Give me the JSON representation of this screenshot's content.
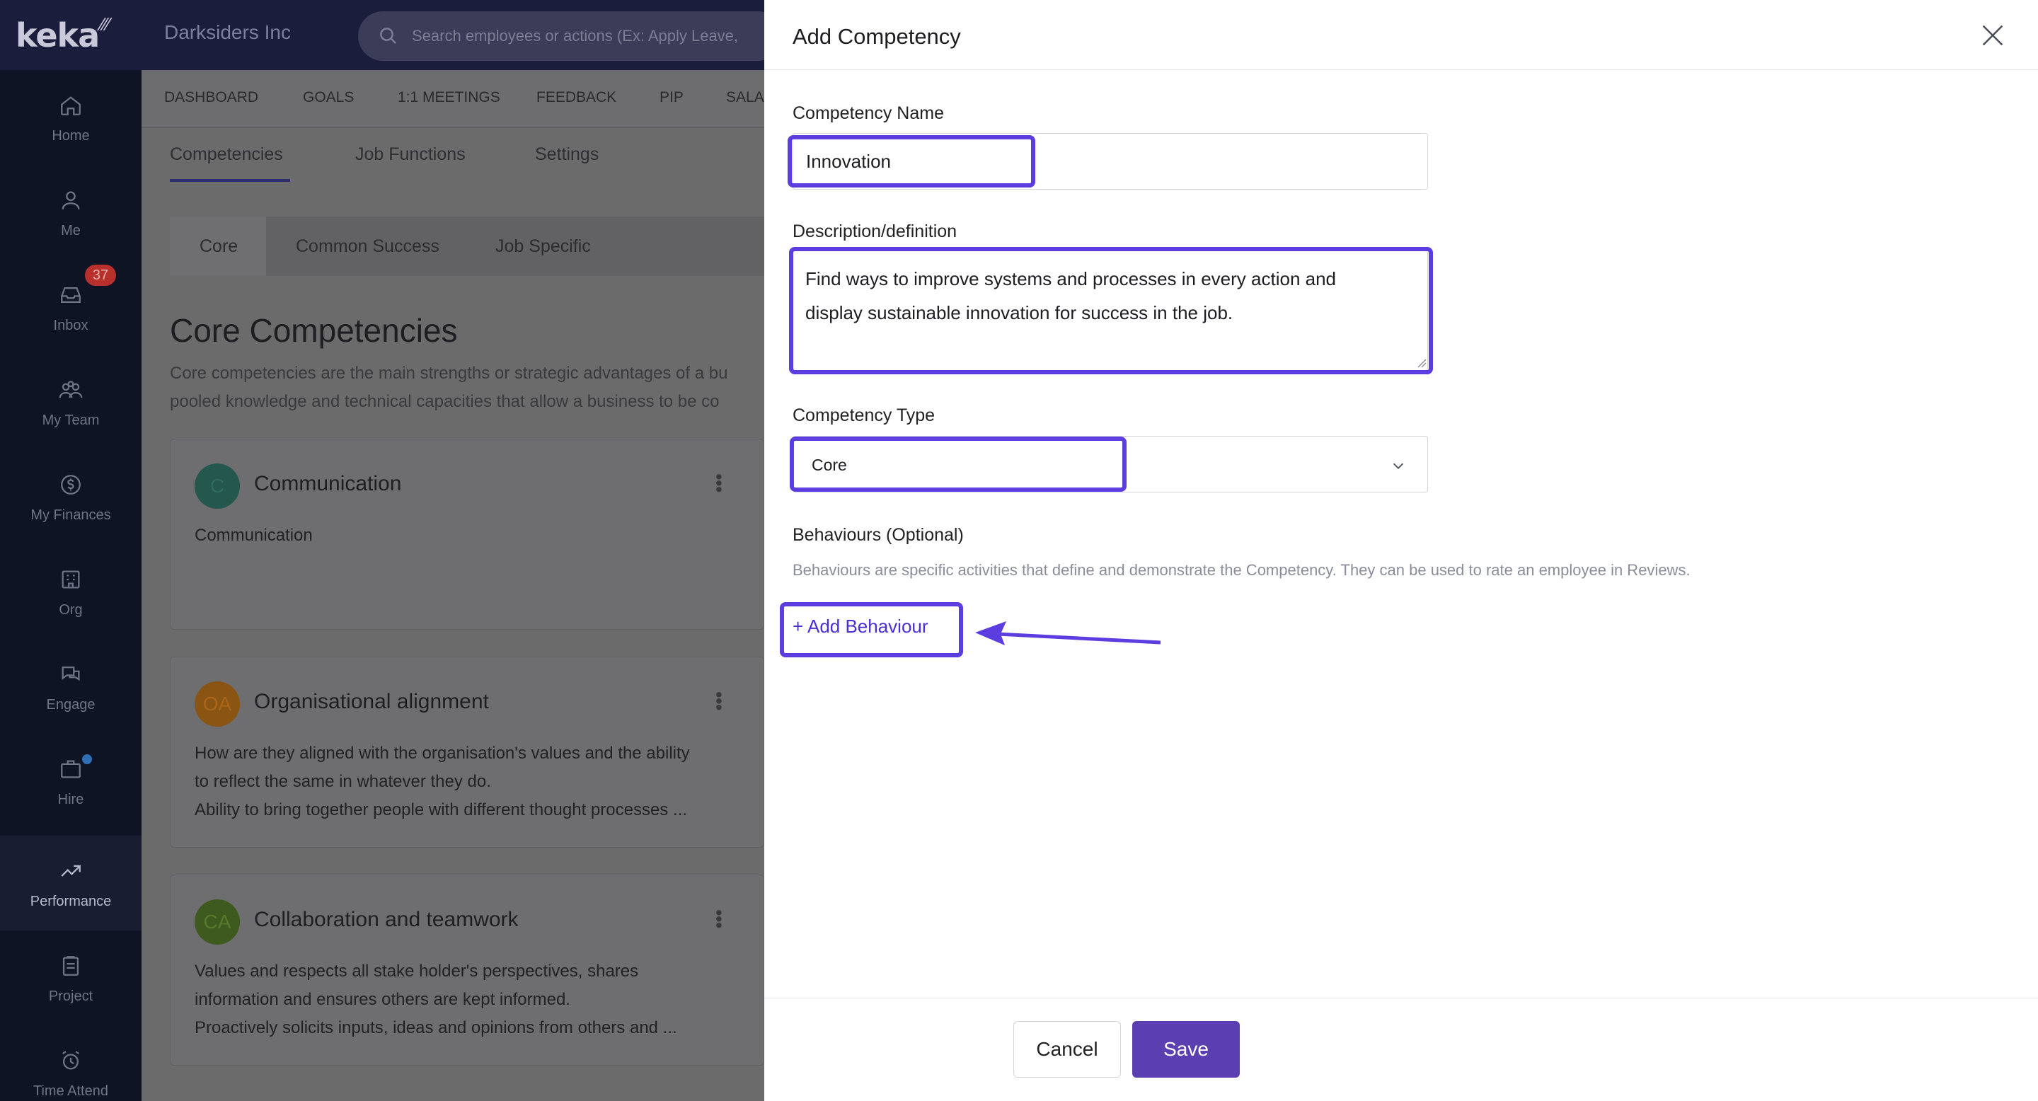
{
  "app": {
    "logo": "keka",
    "company": "Darksiders Inc",
    "search_placeholder": "Search employees or actions (Ex: Apply Leave,"
  },
  "sidebar": {
    "items": [
      {
        "label": "Home",
        "icon": "home-icon"
      },
      {
        "label": "Me",
        "icon": "user-icon"
      },
      {
        "label": "Inbox",
        "icon": "inbox-icon",
        "badge": "37"
      },
      {
        "label": "My Team",
        "icon": "team-icon"
      },
      {
        "label": "My Finances",
        "icon": "finances-icon"
      },
      {
        "label": "Org",
        "icon": "org-icon"
      },
      {
        "label": "Engage",
        "icon": "engage-icon"
      },
      {
        "label": "Hire",
        "icon": "briefcase-icon"
      },
      {
        "label": "Performance",
        "icon": "trend-up-icon",
        "active": true
      },
      {
        "label": "Project",
        "icon": "clipboard-icon"
      },
      {
        "label": "Time Attend",
        "icon": "alarm-icon"
      }
    ]
  },
  "subnav": [
    "DASHBOARD",
    "GOALS",
    "1:1 MEETINGS",
    "FEEDBACK",
    "PIP",
    "SALA"
  ],
  "tabs": [
    "Competencies",
    "Job Functions",
    "Settings"
  ],
  "segments": [
    "Core",
    "Common Success",
    "Job Specific"
  ],
  "page": {
    "title": "Core Competencies",
    "desc_line1": "Core competencies are the main strengths or strategic advantages of a bu",
    "desc_line2": "pooled knowledge and technical capacities that allow a business to be co"
  },
  "cards": [
    {
      "initials": "C",
      "title": "Communication",
      "lines": [
        "Communication"
      ]
    },
    {
      "initials": "OA",
      "title": "Organisational alignment",
      "lines": [
        "How are they aligned with the organisation's values and the ability",
        "to reflect the same in whatever they do.",
        "Ability to bring together people with different thought processes ..."
      ]
    },
    {
      "initials": "CA",
      "title": "Collaboration and teamwork",
      "lines": [
        "Values and respects all stake holder's perspectives, shares",
        "information and ensures others are kept informed.",
        "Proactively solicits inputs, ideas and opinions from others and ..."
      ]
    }
  ],
  "modal": {
    "title": "Add Competency",
    "name_label": "Competency Name",
    "name_value": "Innovation",
    "desc_label": "Description/definition",
    "desc_value": "Find ways to improve systems and processes in every action and display sustainable innovation for success in the job.",
    "type_label": "Competency Type",
    "type_value": "Core",
    "behaviours_label": "Behaviours (Optional)",
    "behaviours_hint": "Behaviours are specific activities that define and demonstrate the Competency. They can be used to rate an employee in Reviews.",
    "add_behaviour": "+ Add Behaviour",
    "cancel": "Cancel",
    "save": "Save"
  },
  "colors": {
    "highlight": "#5b3de0",
    "save_button": "#5b3fb1",
    "link": "#4b2fd6"
  }
}
